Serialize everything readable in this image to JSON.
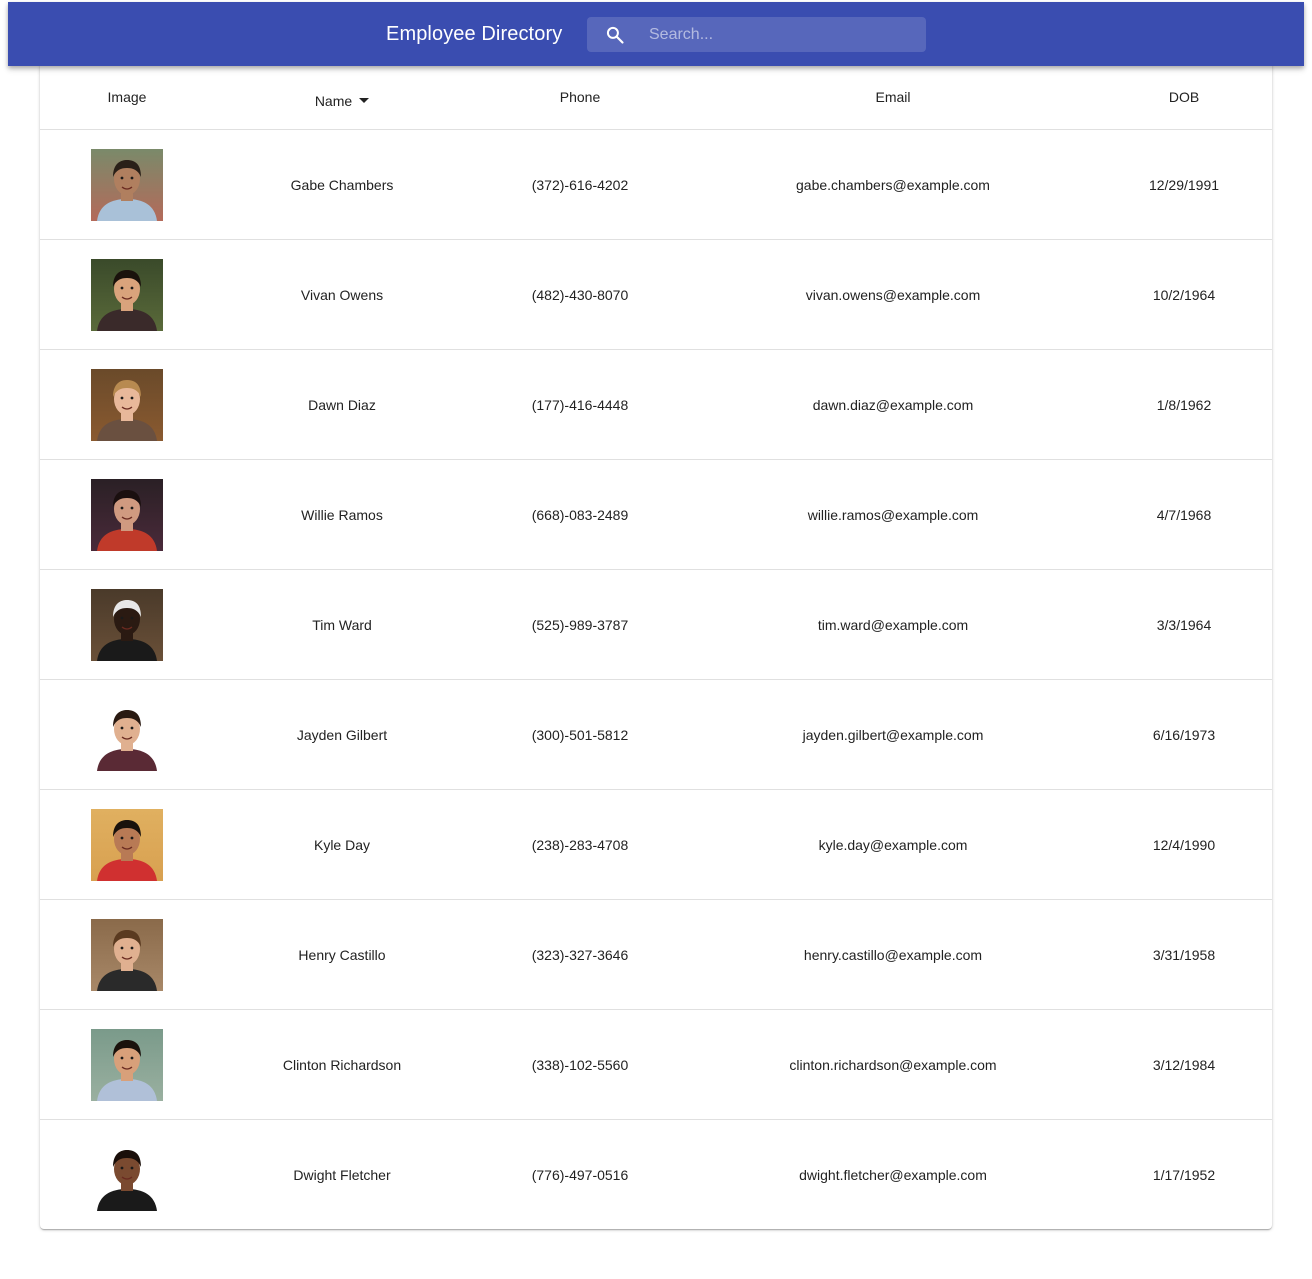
{
  "header": {
    "title": "Employee Directory",
    "search_placeholder": "Search..."
  },
  "table": {
    "columns": {
      "image": "Image",
      "name": "Name",
      "phone": "Phone",
      "email": "Email",
      "dob": "DOB"
    },
    "sort_column": "Name",
    "rows": [
      {
        "name": "Gabe Chambers",
        "phone": "(372)-616-4202",
        "email": "gabe.chambers@example.com",
        "dob": "12/29/1991",
        "bg": "#7a8a6a",
        "bg2": "#b46a5a",
        "skin": "#b07f5f",
        "hair": "#2a2018",
        "shirt": "#a9c1d8"
      },
      {
        "name": "Vivan Owens",
        "phone": "(482)-430-8070",
        "email": "vivan.owens@example.com",
        "dob": "10/2/1964",
        "bg": "#3a4a2a",
        "bg2": "#5a6a3a",
        "skin": "#d9a37c",
        "hair": "#1a120c",
        "shirt": "#3a2a2a"
      },
      {
        "name": "Dawn Diaz",
        "phone": "(177)-416-4448",
        "email": "dawn.diaz@example.com",
        "dob": "1/8/1962",
        "bg": "#6a4a2a",
        "bg2": "#8a5a30",
        "skin": "#e8b89a",
        "hair": "#b88a50",
        "shirt": "#6a5040"
      },
      {
        "name": "Willie Ramos",
        "phone": "(668)-083-2489",
        "email": "willie.ramos@example.com",
        "dob": "4/7/1968",
        "bg": "#2a2025",
        "bg2": "#4a2a3a",
        "skin": "#d09a80",
        "hair": "#1a0f0f",
        "shirt": "#c03a2a"
      },
      {
        "name": "Tim Ward",
        "phone": "(525)-989-3787",
        "email": "tim.ward@example.com",
        "dob": "3/3/1964",
        "bg": "#4a3a2a",
        "bg2": "#6a5038",
        "skin": "#2a1a12",
        "hair": "#e8e8e8",
        "shirt": "#1a1a1a"
      },
      {
        "name": "Jayden Gilbert",
        "phone": "(300)-501-5812",
        "email": "jayden.gilbert@example.com",
        "dob": "6/16/1973",
        "bg": "#ffffff",
        "bg2": "#ffffff",
        "skin": "#e0b090",
        "hair": "#2a1a12",
        "shirt": "#5a2a35"
      },
      {
        "name": "Kyle Day",
        "phone": "(238)-283-4708",
        "email": "kyle.day@example.com",
        "dob": "12/4/1990",
        "bg": "#e0b060",
        "bg2": "#d8a050",
        "skin": "#b87a55",
        "hair": "#1a120c",
        "shirt": "#d03030"
      },
      {
        "name": "Henry Castillo",
        "phone": "(323)-327-3646",
        "email": "henry.castillo@example.com",
        "dob": "3/31/1958",
        "bg": "#8a6a4a",
        "bg2": "#a88868",
        "skin": "#e0b090",
        "hair": "#5a3a20",
        "shirt": "#2a2a2a"
      },
      {
        "name": "Clinton Richardson",
        "phone": "(338)-102-5560",
        "email": "clinton.richardson@example.com",
        "dob": "3/12/1984",
        "bg": "#7a9a8a",
        "bg2": "#9ab0a0",
        "skin": "#d8a07a",
        "hair": "#1a120c",
        "shirt": "#b0c0d8"
      },
      {
        "name": "Dwight Fletcher",
        "phone": "(776)-497-0516",
        "email": "dwight.fletcher@example.com",
        "dob": "1/17/1952",
        "bg": "#ffffff",
        "bg2": "#ffffff",
        "skin": "#7a4a30",
        "hair": "#1a0f0a",
        "shirt": "#1a1a1a"
      }
    ]
  }
}
